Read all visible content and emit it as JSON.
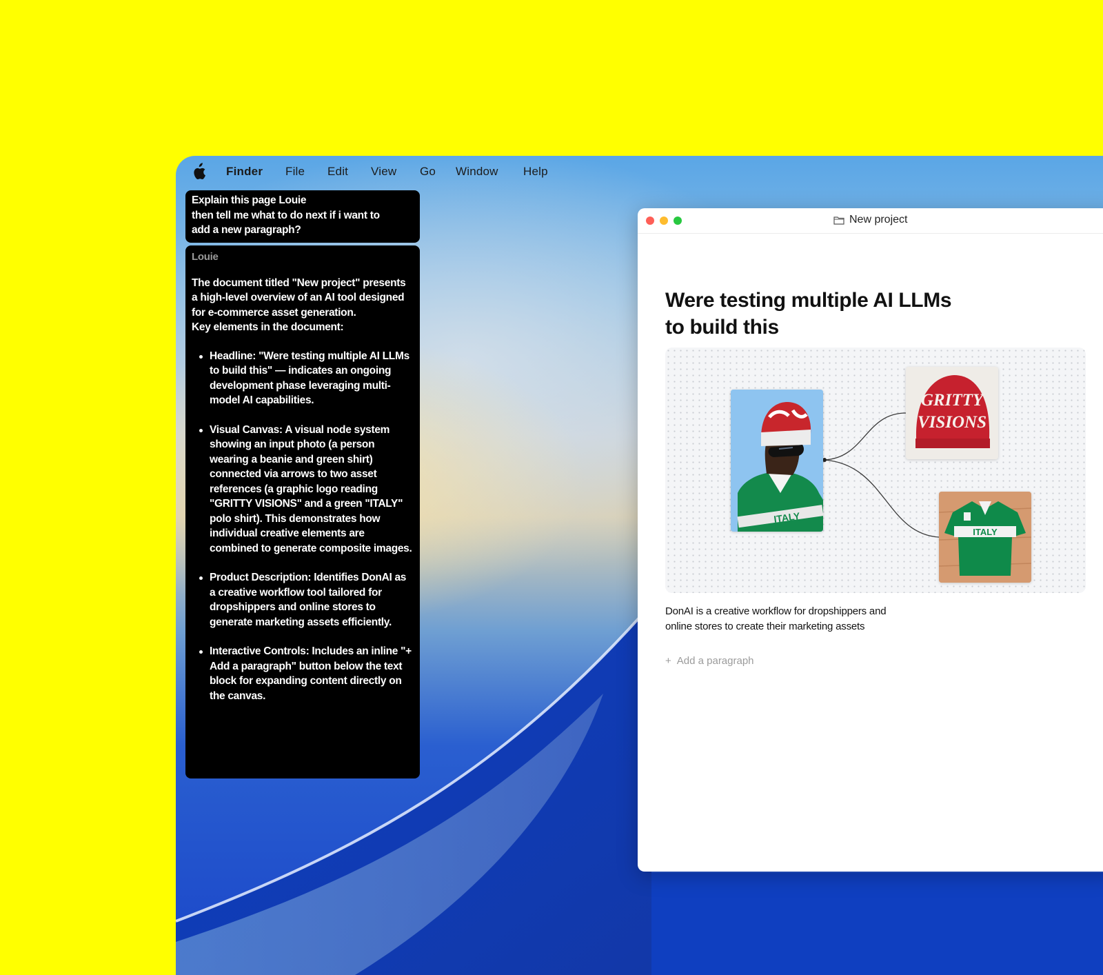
{
  "menubar": {
    "apple_icon": "apple-logo-icon",
    "items": [
      "Finder",
      "File",
      "Edit",
      "View",
      "Go",
      "Window",
      "Help"
    ]
  },
  "chat": {
    "user_message": [
      "Explain this page Louie",
      "then tell me what to do next if i want to",
      "add a new paragraph?"
    ],
    "assistant_name": "Louie",
    "reply_intro": "The document titled \"New project\" presents a high-level overview of an AI tool designed for e-commerce asset generation.",
    "reply_key": "Key elements in the document:",
    "reply_items": [
      "Headline: \"Were testing multiple AI LLMs to build this\" — indicates an ongoing development phase leveraging multi-model AI capabilities.",
      "Visual Canvas: A visual node system showing an input photo (a person wearing a beanie and green shirt) connected via arrows to two asset references (a graphic logo reading \"GRITTY VISIONS\" and a green \"ITALY\" polo shirt). This demonstrates how individual creative elements are combined to generate composite images.",
      "Product Description: Identifies DonAI as a creative workflow tool tailored for dropshippers and online stores to generate marketing assets efficiently.",
      "Interactive Controls: Includes an inline \"+ Add a paragraph\" button below the text block for expanding content directly on the canvas."
    ]
  },
  "window": {
    "title": "New project",
    "folder_icon": "folder-icon",
    "heading": "Were testing multiple AI LLMs to build this",
    "description": "DonAI is a creative workflow for dropshippers and online stores to create their marketing assets",
    "add_paragraph_symbol": "+",
    "add_paragraph_label": "Add a paragraph",
    "canvas": {
      "beanie_text": [
        "GRITTY",
        "VISIONS"
      ],
      "shirt_text": "ITALY",
      "person_shirt_text": "ITALY"
    }
  },
  "colors": {
    "background": "#ffff00",
    "traffic_close": "#fe5f57",
    "traffic_min": "#febc2e",
    "traffic_max": "#28c840"
  }
}
